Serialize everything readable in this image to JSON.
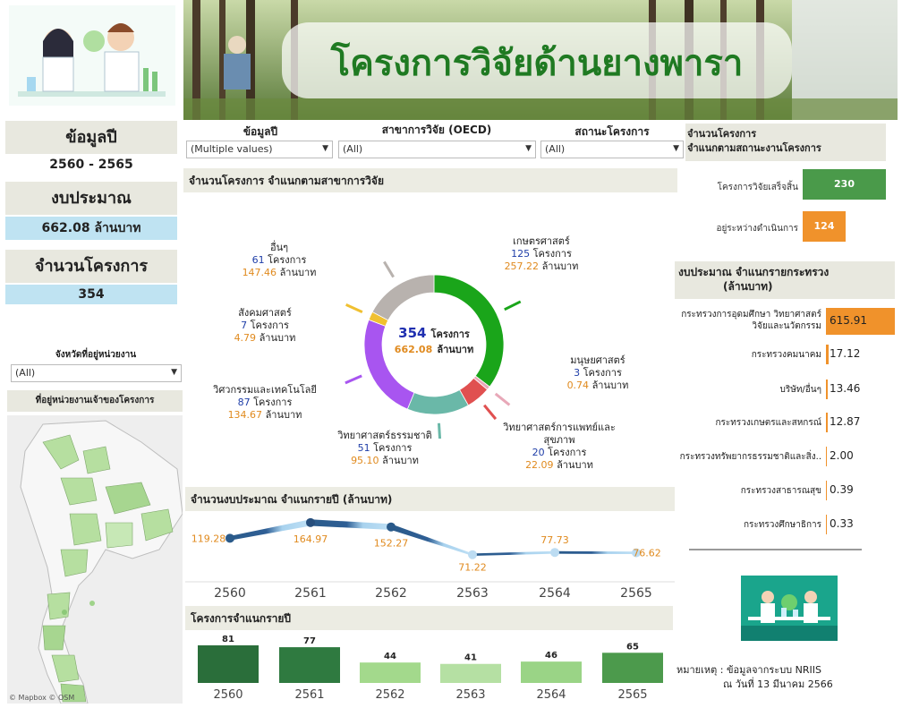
{
  "header": {
    "title": "โครงการวิจัยด้านยางพารา"
  },
  "kpi": {
    "year_label": "ข้อมูลปี",
    "year_value": "2560 - 2565",
    "budget_label": "งบประมาณ",
    "budget_value": "662.08 ล้านบาท",
    "projects_label": "จำนวนโครงการ",
    "projects_value": "354"
  },
  "filters": {
    "year": {
      "label": "ข้อมูลปี",
      "value": "(Multiple values)"
    },
    "field": {
      "label": "สาขาการวิจัย (OECD)",
      "value": "(All)"
    },
    "status": {
      "label": "สถานะโครงการ",
      "value": "(All)"
    },
    "province": {
      "label": "จังหวัดที่อยู่หน่วยงาน",
      "value": "(All)"
    }
  },
  "map": {
    "title": "ที่อยู่หน่วยงานเจ้าของโครงการ",
    "attribution": "© Mapbox © OSM"
  },
  "donut": {
    "title": "จำนวนโครงการ จำแนกตามสาขาการวิจัย",
    "center_count": "354",
    "center_count_unit": "โครงการ",
    "center_budget": "662.08",
    "center_budget_unit": "ล้านบาท",
    "project_unit": "โครงการ",
    "budget_unit": "ล้านบาท",
    "segments": [
      {
        "name": "เกษตรศาสตร์",
        "count": "125",
        "budget": "257.22",
        "value": 125,
        "color": "#1aa51a"
      },
      {
        "name": "มนุษยศาสตร์",
        "count": "3",
        "budget": "0.74",
        "value": 3,
        "color": "#e8a8b8"
      },
      {
        "name": "วิทยาศาสตร์การแพทย์และสุขภาพ",
        "count": "20",
        "budget": "22.09",
        "value": 20,
        "color": "#e05050"
      },
      {
        "name": "วิทยาศาสตร์ธรรมชาติ",
        "count": "51",
        "budget": "95.10",
        "value": 51,
        "color": "#6ab8a8"
      },
      {
        "name": "วิศวกรรมและเทคโนโลยี",
        "count": "87",
        "budget": "134.67",
        "value": 87,
        "color": "#a855f0"
      },
      {
        "name": "สังคมศาสตร์",
        "count": "7",
        "budget": "4.79",
        "value": 7,
        "color": "#f0c030"
      },
      {
        "name": "อื่นๆ",
        "count": "61",
        "budget": "147.46",
        "value": 61,
        "color": "#b8b2ae"
      }
    ]
  },
  "status_panel": {
    "title_line1": "จำนวนโครงการ",
    "title_line2": "จำแนกตามสถานะงานโครงการ",
    "items": [
      {
        "label": "โครงการวิจัยเสร็จสิ้น",
        "value": "230",
        "color": "#4a9a4a"
      },
      {
        "label": "อยู่ระหว่างดำเนินการ",
        "value": "124",
        "color": "#f0922b"
      }
    ]
  },
  "ministry_panel": {
    "title_line1": "งบประมาณ จำแนกรายกระทรวง",
    "title_line2": "(ล้านบาท)",
    "items": [
      {
        "name_line1": "กระทรวงการอุดมศึกษา วิทยาศาสตร์",
        "name_line2": "วิจัยและนวัตกรรม",
        "value": "615.91",
        "num": 615.91
      },
      {
        "name_line1": "กระทรวงคมนาคม",
        "name_line2": "",
        "value": "17.12",
        "num": 17.12
      },
      {
        "name_line1": "บริษัท/อื่นๆ",
        "name_line2": "",
        "value": "13.46",
        "num": 13.46
      },
      {
        "name_line1": "กระทรวงเกษตรและสหกรณ์",
        "name_line2": "",
        "value": "12.87",
        "num": 12.87
      },
      {
        "name_line1": "กระทรวงทรัพยากรธรรมชาติและสิ่ง..",
        "name_line2": "",
        "value": "2.00",
        "num": 2.0
      },
      {
        "name_line1": "กระทรวงสาธารณสุข",
        "name_line2": "",
        "value": "0.39",
        "num": 0.39
      },
      {
        "name_line1": "กระทรวงศึกษาธิการ",
        "name_line2": "",
        "value": "0.33",
        "num": 0.33
      }
    ]
  },
  "note": {
    "line1": "หมายเหตุ : ข้อมูลจากระบบ NRIIS",
    "line2": "ณ วันที่ 13 มีนาคม 2566"
  },
  "chart_data": [
    {
      "type": "line",
      "title": "จำนวนงบประมาณ จำแนกรายปี (ล้านบาท)",
      "categories": [
        "2560",
        "2561",
        "2562",
        "2563",
        "2564",
        "2565"
      ],
      "values": [
        119.28,
        164.97,
        152.27,
        71.22,
        77.73,
        76.62
      ],
      "labels": [
        "119.28",
        "164.97",
        "152.27",
        "71.22",
        "77.73",
        "76.62"
      ]
    },
    {
      "type": "bar",
      "title": "โครงการจำแนกรายปี",
      "categories": [
        "2560",
        "2561",
        "2562",
        "2563",
        "2564",
        "2565"
      ],
      "values": [
        81,
        77,
        44,
        41,
        46,
        65
      ],
      "colors": [
        "#2a6e3a",
        "#2f7a40",
        "#a3d98c",
        "#b5e0a3",
        "#9ad486",
        "#4c9a4c"
      ]
    }
  ]
}
